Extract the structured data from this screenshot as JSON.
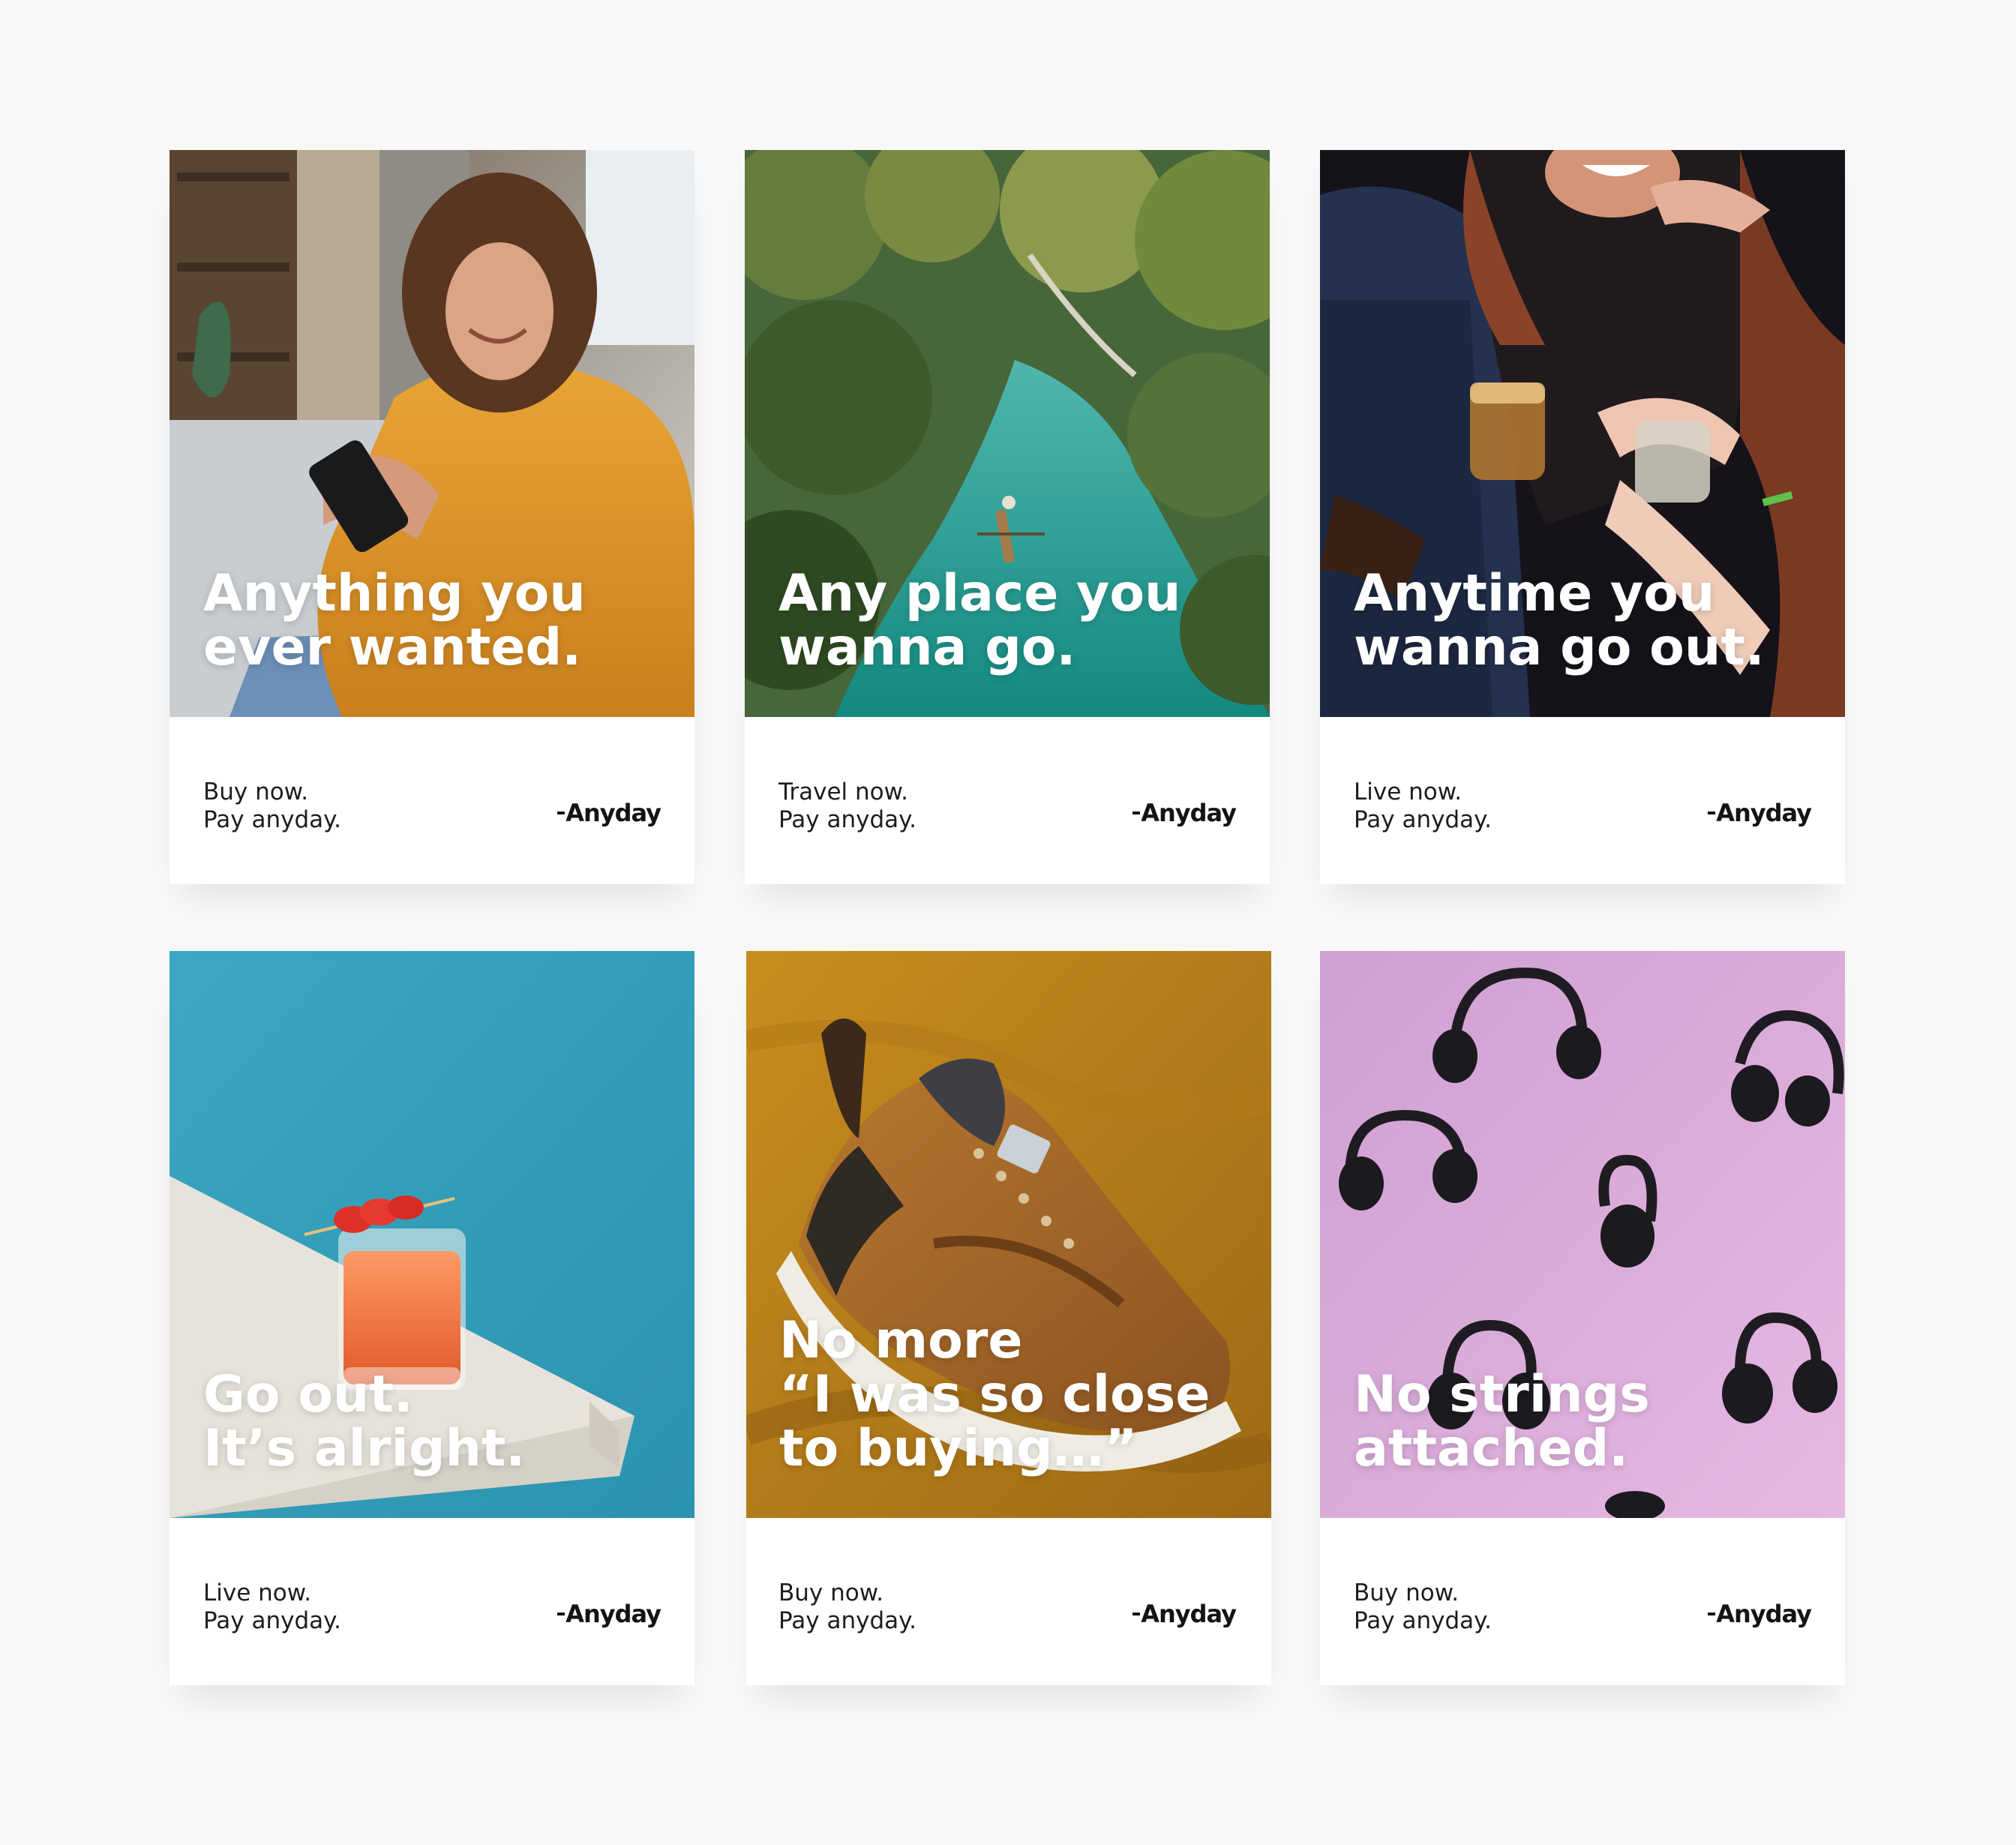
{
  "brand": {
    "name": "Anyday"
  },
  "cards": [
    {
      "headline": "Anything you\never wanted.",
      "tagline_1": "Buy now.",
      "tagline_2": "Pay anyday.",
      "image": "woman-in-yellow-hoodie-with-phone"
    },
    {
      "headline": "Any place you\nwanna go.",
      "tagline_1": "Travel now.",
      "tagline_2": "Pay anyday.",
      "image": "tropical-river-with-canoe"
    },
    {
      "headline": "Anytime you\nwanna go out.",
      "tagline_1": "Live now.",
      "tagline_2": "Pay anyday.",
      "image": "friends-with-drinks-at-night"
    },
    {
      "headline": "Go out.\nIt’s alright.",
      "tagline_1": "Live now.",
      "tagline_2": "Pay anyday.",
      "image": "cocktail-on-table-blue-background"
    },
    {
      "headline": "No more\n“I was so close\nto buying…”",
      "tagline_1": "Buy now.",
      "tagline_2": "Pay anyday.",
      "image": "brown-sneaker-on-mustard-fabric"
    },
    {
      "headline": "No strings\nattached.",
      "tagline_1": "Buy now.",
      "tagline_2": "Pay anyday.",
      "image": "floating-headphones-pink-background"
    }
  ],
  "colors": {
    "page_background": "#f8f8f8",
    "card_background": "#ffffff",
    "text_dark": "#1d1d1f",
    "headline_text": "#ffffff"
  }
}
